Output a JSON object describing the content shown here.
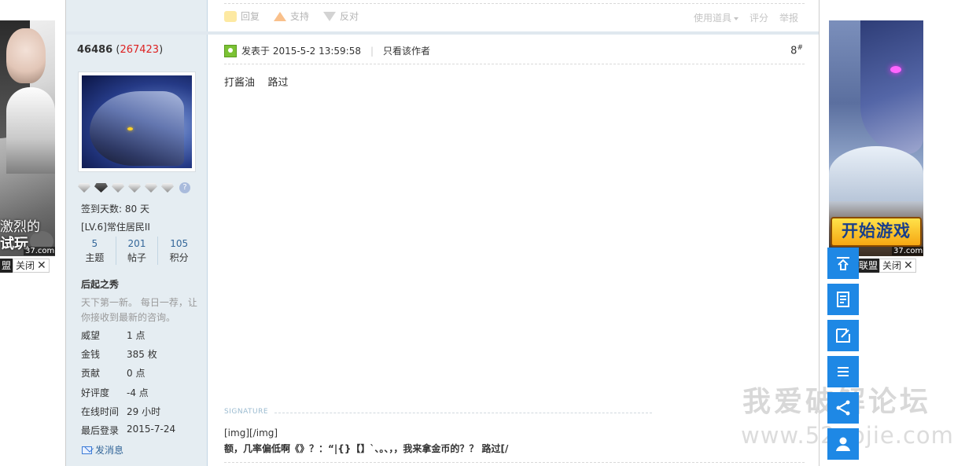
{
  "ads": {
    "left": {
      "slogan_line1": "激烈的",
      "slogan_line2": "试玩",
      "source": "37.com",
      "tag": "盟",
      "close_label": "关闭"
    },
    "right": {
      "play_label": "开始游戏",
      "source": "37.com",
      "tag": "联盟",
      "close_label": "关闭"
    }
  },
  "prev_post_actions": {
    "reply": "回复",
    "support": "支持",
    "oppose": "反对",
    "use_item": "使用道具",
    "rate": "评分",
    "report": "举报"
  },
  "author": {
    "name": "46486",
    "uid_open": " (",
    "uid": "267423",
    "uid_close": ")",
    "checkin": "签到天数: 80 天",
    "level": "[LV.6]常住居民II",
    "stats": [
      {
        "value": "5",
        "label": "主题"
      },
      {
        "value": "201",
        "label": "帖子"
      },
      {
        "value": "105",
        "label": "积分"
      }
    ],
    "rank_title": "后起之秀",
    "rank_desc": "天下第一新。 每日一荐，让你接收到最新的咨询。",
    "details": [
      {
        "k": "威望",
        "v": "1 点"
      },
      {
        "k": "金钱",
        "v": "385 枚"
      },
      {
        "k": "贡献",
        "v": "0 点"
      },
      {
        "k": "好评度",
        "v": "-4 点"
      },
      {
        "k": "在线时间",
        "v": "29 小时"
      },
      {
        "k": "最后登录",
        "v": "2015-7-24"
      }
    ],
    "send_message": "发消息"
  },
  "post": {
    "posted_at": "发表于 2015-5-2 13:59:58",
    "only_author": "只看该作者",
    "floor": "8",
    "floor_mark": "#",
    "content": "打酱油    路过",
    "signature_label": "SIGNATURE",
    "signature_line1": "[img][/img]",
    "signature_line2": "额，几率偏低啊《》？：“|{}【】`、。、，，我来拿金币的？？ 路过[/"
  },
  "watermark": {
    "line1": "我爱破解论坛",
    "line2": "www.52pojie.com"
  },
  "toolbar": [
    "back-to-top",
    "post-list",
    "reply",
    "menu",
    "share",
    "profile"
  ]
}
